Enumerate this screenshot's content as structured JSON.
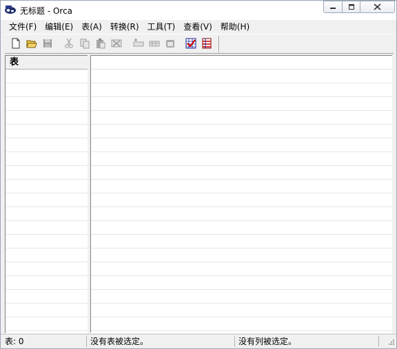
{
  "window": {
    "title": "无标题 - Orca"
  },
  "menu": [
    "文件(F)",
    "编辑(E)",
    "表(A)",
    "转换(R)",
    "工具(T)",
    "查看(V)",
    "帮助(H)"
  ],
  "toolbar": {
    "buttons": [
      {
        "name": "new-icon",
        "enabled": true
      },
      {
        "name": "open-icon",
        "enabled": true
      },
      {
        "name": "save-icon",
        "enabled": false
      },
      {
        "name": "cut-icon",
        "enabled": false
      },
      {
        "name": "copy-icon",
        "enabled": false
      },
      {
        "name": "paste-icon",
        "enabled": false
      },
      {
        "name": "delete-icon",
        "enabled": false
      },
      {
        "name": "add-row-icon",
        "enabled": false
      },
      {
        "name": "add-table-icon",
        "enabled": false
      },
      {
        "name": "table-icon",
        "enabled": false
      },
      {
        "name": "validate-icon",
        "enabled": true
      },
      {
        "name": "merge-module-icon",
        "enabled": true
      }
    ]
  },
  "left_pane": {
    "header": "表"
  },
  "status": {
    "tables": "表: 0",
    "no_table": "没有表被选定。",
    "no_column": "没有列被选定。"
  }
}
